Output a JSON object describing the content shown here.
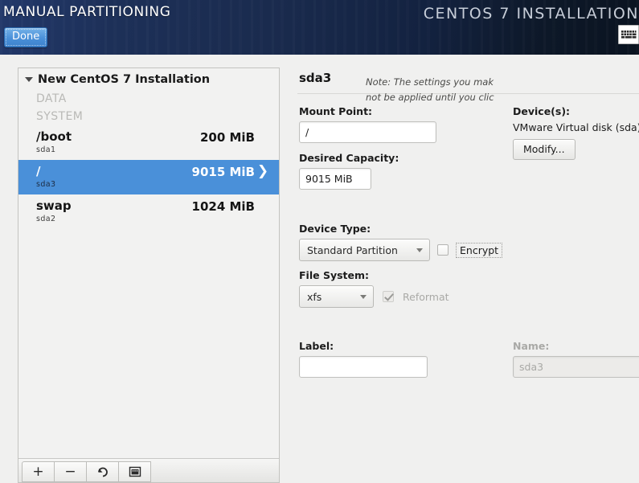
{
  "header": {
    "title": "MANUAL PARTITIONING",
    "done_label": "Done",
    "brand": "CENTOS 7 INSTALLATION",
    "keyboard_icon": "keyboard-layout-icon"
  },
  "sidebar": {
    "root": {
      "label": "New CentOS 7 Installation",
      "expander_icon": "triangle-down-icon"
    },
    "groups": [
      {
        "label": "DATA",
        "items": []
      },
      {
        "label": "SYSTEM",
        "items": [
          {
            "mount": "/boot",
            "device": "sda1",
            "size": "200 MiB",
            "selected": false
          },
          {
            "mount": "/",
            "device": "sda3",
            "size": "9015 MiB",
            "selected": true
          },
          {
            "mount": "swap",
            "device": "sda2",
            "size": "1024 MiB",
            "selected": false
          }
        ]
      }
    ],
    "toolbar": {
      "add_label": "+",
      "remove_label": "−",
      "refresh_icon": "refresh-icon",
      "storage_icon": "storage-config-icon"
    },
    "selected_chevron": "chevron-right-icon"
  },
  "panel": {
    "title": "sda3",
    "mount_point": {
      "label": "Mount Point:",
      "value": "/"
    },
    "desired_capacity": {
      "label": "Desired Capacity:",
      "value": "9015 MiB"
    },
    "devices": {
      "label": "Device(s):",
      "value": "VMware Virtual disk (sda)",
      "modify_label": "Modify..."
    },
    "device_type": {
      "label": "Device Type:",
      "value": "Standard Partition"
    },
    "encrypt": {
      "label": "Encrypt",
      "checked": false
    },
    "file_system": {
      "label": "File System:",
      "value": "xfs"
    },
    "reformat": {
      "label": "Reformat",
      "checked": true,
      "disabled": true
    },
    "label_field": {
      "label": "Label:",
      "value": ""
    },
    "name_field": {
      "label": "Name:",
      "value": "sda3",
      "disabled": true
    },
    "note_line1": "Note:  The settings you mak",
    "note_line2": "not be applied until you clic"
  },
  "colors": {
    "selection_blue": "#4a90d9",
    "header_navy": "#1c3156",
    "panel_bg": "#f0f0ef"
  }
}
